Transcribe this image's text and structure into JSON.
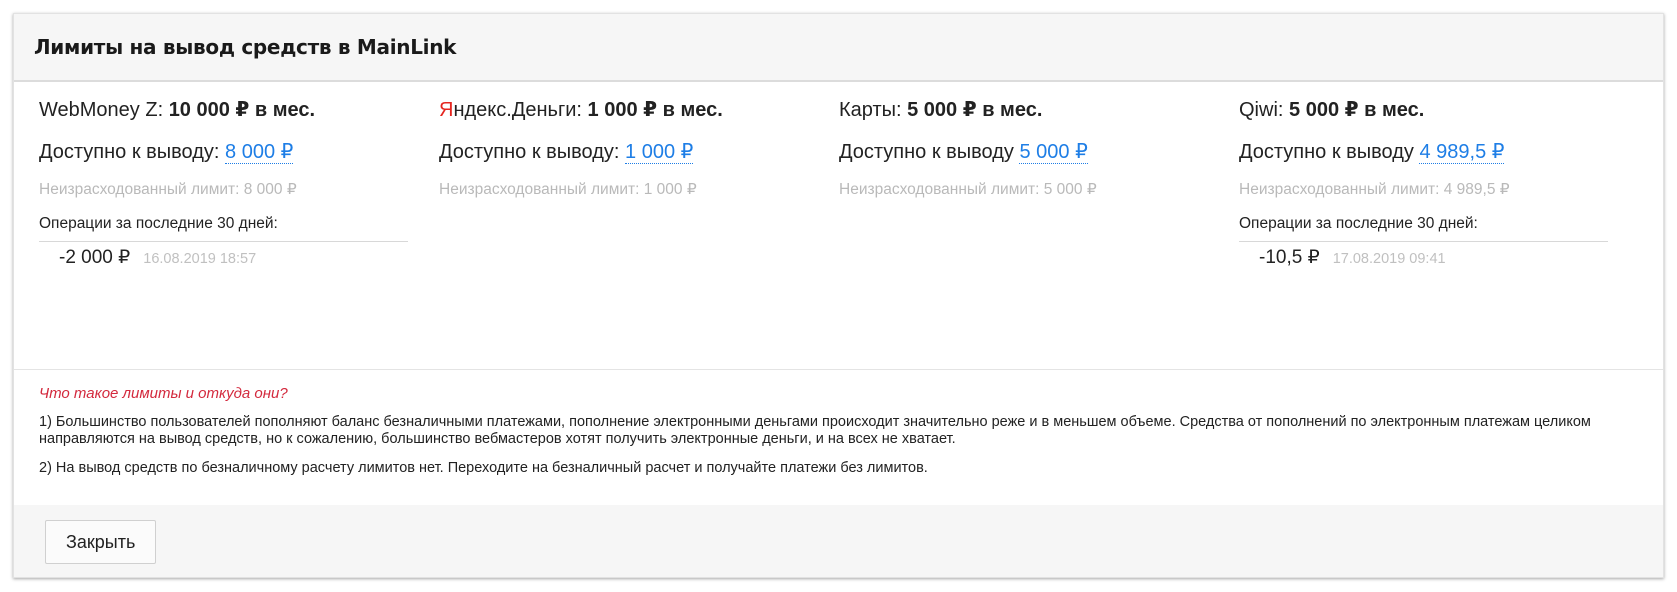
{
  "modal": {
    "title": "Лимиты на вывод средств в MainLink"
  },
  "colors": {
    "link": "#1e7ee6",
    "faq_question": "#d3293d",
    "yandex_y": "#e52620",
    "muted": "#b9b9b9"
  },
  "limits": [
    {
      "name": "WebMoney Z:",
      "limit": "10 000 ₽ в мес.",
      "available_label": "Доступно к выводу:",
      "available_value": "8 000 ₽",
      "unused": "Неизрасходованный лимит: 8 000 ₽",
      "ops_title": "Операции за последние 30 дней:",
      "ops": [
        {
          "amount": "-2 000 ₽",
          "date": "16.08.2019 18:57"
        }
      ]
    },
    {
      "name_first": "Я",
      "name_rest": "ндекс.Деньги:",
      "limit": "1 000 ₽ в мес.",
      "available_label": "Доступно к выводу:",
      "available_value": "1 000 ₽",
      "unused": "Неизрасходованный лимит: 1 000 ₽"
    },
    {
      "name": "Карты:",
      "limit": "5 000 ₽ в мес.",
      "available_label": "Доступно к выводу",
      "available_value": "5 000 ₽",
      "unused": "Неизрасходованный лимит: 5 000 ₽"
    },
    {
      "name": "Qiwi:",
      "limit": "5 000 ₽ в мес.",
      "available_label": "Доступно к выводу",
      "available_value": "4 989,5 ₽",
      "unused": "Неизрасходованный лимит: 4 989,5 ₽",
      "ops_title": "Операции за последние 30 дней:",
      "ops": [
        {
          "amount": "-10,5 ₽",
          "date": "17.08.2019 09:41"
        }
      ]
    }
  ],
  "faq": {
    "question": "Что такое лимиты и откуда они?",
    "paragraphs": [
      "1) Большинство пользователей пополняют баланс безналичными платежами, пополнение электронными деньгами происходит значительно реже и в меньшем объеме. Средства от пополнений по электронным платежам целиком направляются на вывод средств, но к сожалению, большинство вебмастеров хотят получить электронные деньги, и на всех не хватает.",
      "2) На вывод средств по безналичному расчету лимитов нет. Переходите на безналичный расчет и получайте платежи без лимитов."
    ]
  },
  "footer": {
    "close_label": "Закрыть"
  }
}
